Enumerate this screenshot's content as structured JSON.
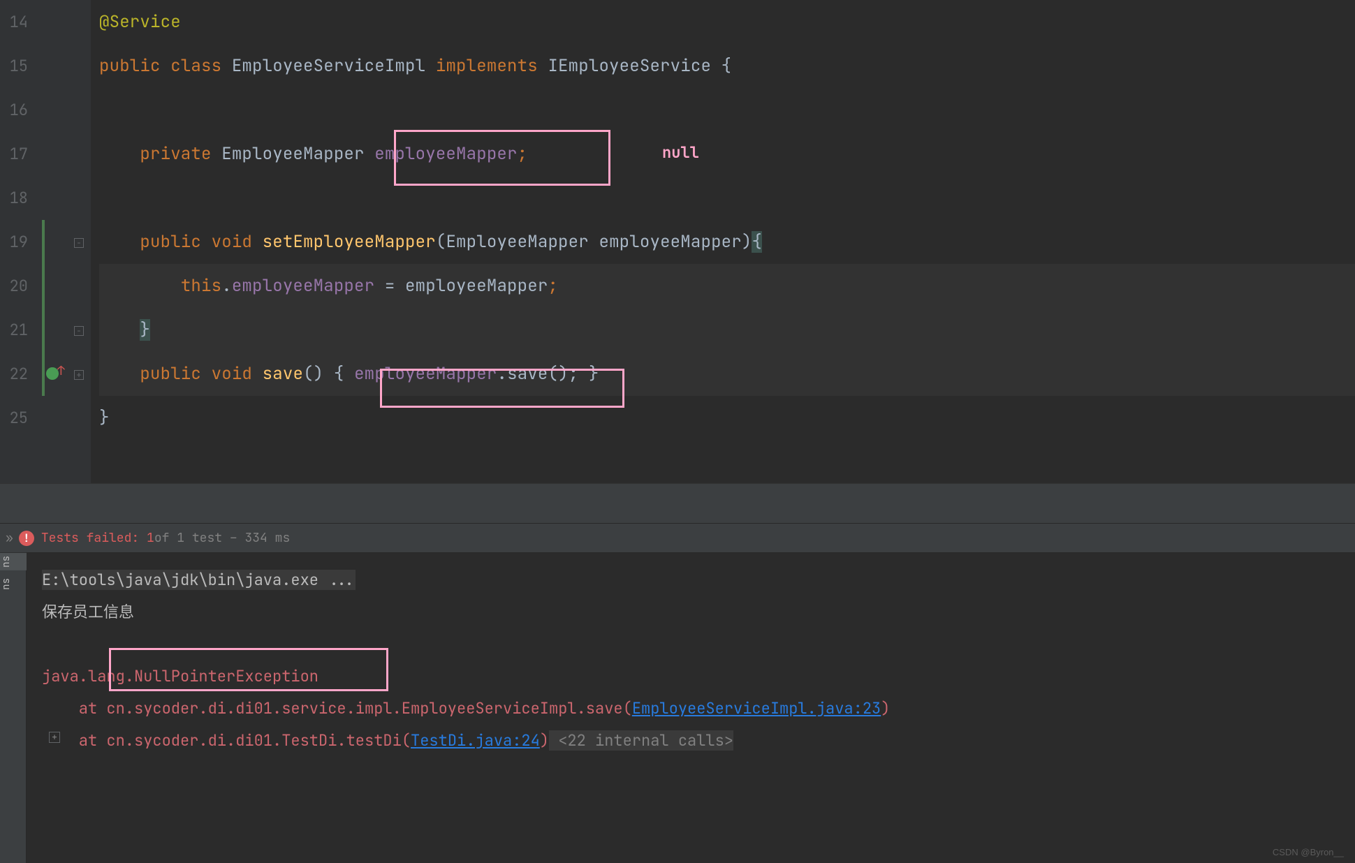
{
  "editor": {
    "line_numbers": [
      "14",
      "15",
      "16",
      "17",
      "18",
      "19",
      "20",
      "21",
      "22",
      "25"
    ],
    "lines": {
      "l14": {
        "ann": "@Service"
      },
      "l15": {
        "kw1": "public",
        "kw2": "class",
        "cls": "EmployeeServiceImpl",
        "kw3": "implements",
        "iface": "IEmployeeService",
        "br": "{"
      },
      "l17": {
        "kw": "private",
        "type": "EmployeeMapper",
        "field": "employeeMapper",
        "semi": ";"
      },
      "l19": {
        "kw1": "public",
        "kw2": "void",
        "mth": "setEmployeeMapper",
        "lp": "(",
        "ptype": "EmployeeMapper",
        "pname": "employeeMapper",
        "rp": ")",
        "br": "{"
      },
      "l20": {
        "kw": "this",
        "dot": ".",
        "field": "employeeMapper",
        "eq": " = ",
        "rhs": "employeeMapper",
        "semi": ";"
      },
      "l21": {
        "br": "}"
      },
      "l22": {
        "kw1": "public",
        "kw2": "void",
        "mth": "save",
        "parens": "()",
        "lb": "{",
        "field": "employeeMapper",
        "dot": ".",
        "call": "save",
        "callp": "();",
        "rb": "}"
      },
      "l25": {
        "br": "}"
      }
    },
    "null_annotation": "null"
  },
  "test_bar": {
    "label": "Tests failed:",
    "count": "1",
    "rest": " of 1 test – 334 ms"
  },
  "console": {
    "cmd": "E:\\tools\\java\\jdk\\bin\\java.exe ...",
    "out1": "保存员工信息",
    "exc": "java.lang.NullPointerException",
    "at1_pre": "    at cn.sycoder.di.di01.service.impl.EmployeeServiceImpl.save(",
    "at1_link": "EmployeeServiceImpl.java:23",
    "at1_post": ")",
    "at2_pre": "    at cn.sycoder.di.di01.TestDi.testDi(",
    "at2_link": "TestDi.java:24",
    "at2_post": ")",
    "internal": " <22 internal calls>"
  },
  "side_tabs": {
    "t1": "ns",
    "t2": "ns"
  },
  "watermark": "CSDN @Byron__"
}
